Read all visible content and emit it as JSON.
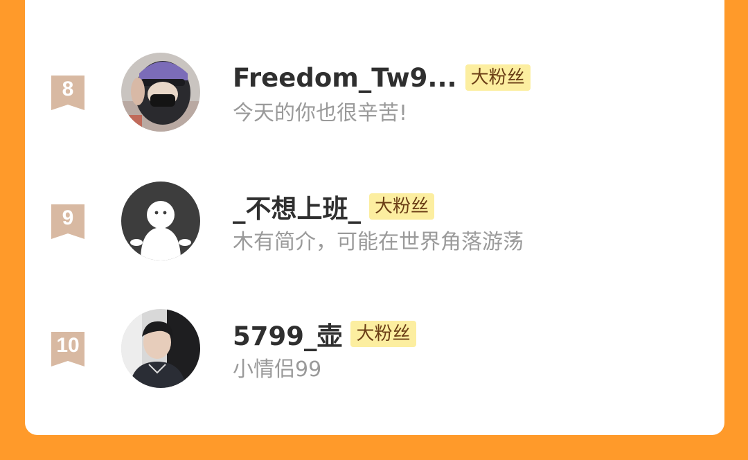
{
  "badge_color": "#FCEEA0",
  "rank_color": "#D8B9A2",
  "background_color": "#FF9A2A",
  "rows": [
    {
      "rank": "8",
      "name": "Freedom_Tw9...",
      "badge": "大粉丝",
      "bio": "今天的你也很辛苦!",
      "avatar": "helmet-photo"
    },
    {
      "rank": "9",
      "name": "_不想上班_",
      "badge": "大粉丝",
      "bio": "木有简介，可能在世界角落游荡",
      "avatar": "default-user-icon"
    },
    {
      "rank": "10",
      "name": "5799_壶",
      "badge": "大粉丝",
      "bio": "小情侣99",
      "avatar": "person-photo"
    }
  ]
}
